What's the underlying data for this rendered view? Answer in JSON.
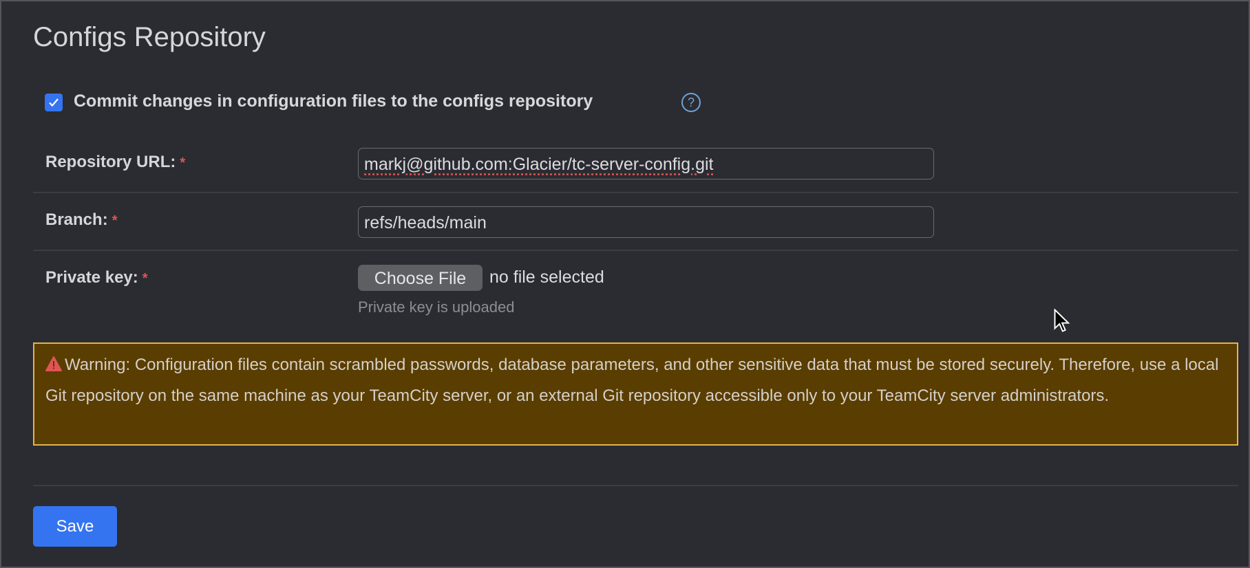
{
  "page": {
    "title": "Configs Repository"
  },
  "commit_checkbox": {
    "label": "Commit changes in configuration files to the configs repository",
    "checked": true,
    "help_icon": "question-circle-icon"
  },
  "fields": {
    "repository_url": {
      "label": "Repository URL:",
      "required_mark": "*",
      "value": "markj@github.com:Glacier/tc-server-config.git"
    },
    "branch": {
      "label": "Branch:",
      "required_mark": "*",
      "value": "refs/heads/main"
    },
    "private_key": {
      "label": "Private key:",
      "required_mark": "*",
      "button_label": "Choose File",
      "file_status": "no file selected",
      "hint": "Private key is uploaded"
    }
  },
  "warning": {
    "icon": "warning-triangle-icon",
    "text": "Warning: Configuration files contain scrambled passwords, database parameters, and other sensitive data that must be stored securely. Therefore, use a local Git repository on the same machine as your TeamCity server, or an external Git repository accessible only to your TeamCity server administrators."
  },
  "actions": {
    "save_label": "Save"
  },
  "colors": {
    "accent": "#3574f0",
    "warning_bg": "#5a3d00",
    "warning_border": "#e2b550",
    "required": "#e05555"
  }
}
